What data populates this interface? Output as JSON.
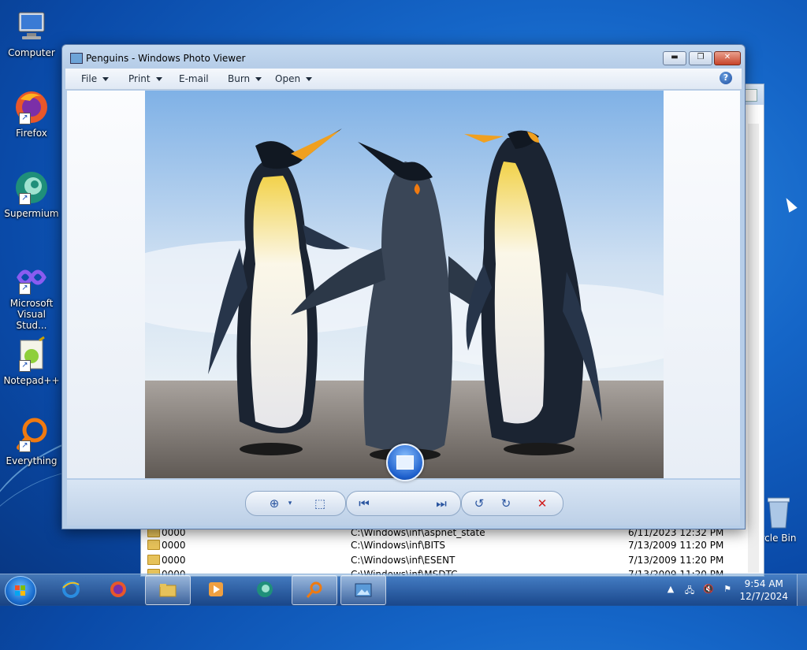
{
  "desktop": {
    "icons": [
      {
        "label": "Computer",
        "icon": "computer-icon"
      },
      {
        "label": "Firefox",
        "icon": "firefox-icon"
      },
      {
        "label": "Supermium",
        "icon": "supermium-icon"
      },
      {
        "label": "Microsoft Visual Stud...",
        "icon": "visual-studio-icon"
      },
      {
        "label": "Notepad++",
        "icon": "notepadpp-icon"
      },
      {
        "label": "Everything",
        "icon": "everything-icon"
      }
    ],
    "recycle_bin_label": "rcle Bin"
  },
  "background_window": {
    "rows": [
      {
        "name": "0000",
        "path": "C:\\Windows\\inf\\aspnet_state",
        "date": "6/11/2023 12:32 PM"
      },
      {
        "name": "0000",
        "path": "C:\\Windows\\inf\\BITS",
        "date": "7/13/2009 11:20 PM"
      },
      {
        "name": "0000",
        "path": "C:\\Windows\\inf\\ESENT",
        "date": "7/13/2009 11:20 PM"
      },
      {
        "name": "0000",
        "path": "C:\\Windows\\inf\\MSDTC",
        "date": "7/13/2009 11:20 PM"
      }
    ]
  },
  "photo_viewer": {
    "title": "Penguins - Windows Photo Viewer",
    "menu": {
      "file": "File",
      "print": "Print",
      "email": "E-mail",
      "burn": "Burn",
      "open": "Open"
    },
    "help_glyph": "?",
    "controls": {
      "zoom": "zoom-icon",
      "fit": "actual-size-icon",
      "previous": "previous-icon",
      "slideshow": "slideshow-icon",
      "next": "next-icon",
      "rotate_ccw": "rotate-counterclockwise-icon",
      "rotate_cw": "rotate-clockwise-icon",
      "delete": "delete-icon"
    }
  },
  "taskbar": {
    "time": "9:54 AM",
    "date": "12/7/2024"
  }
}
